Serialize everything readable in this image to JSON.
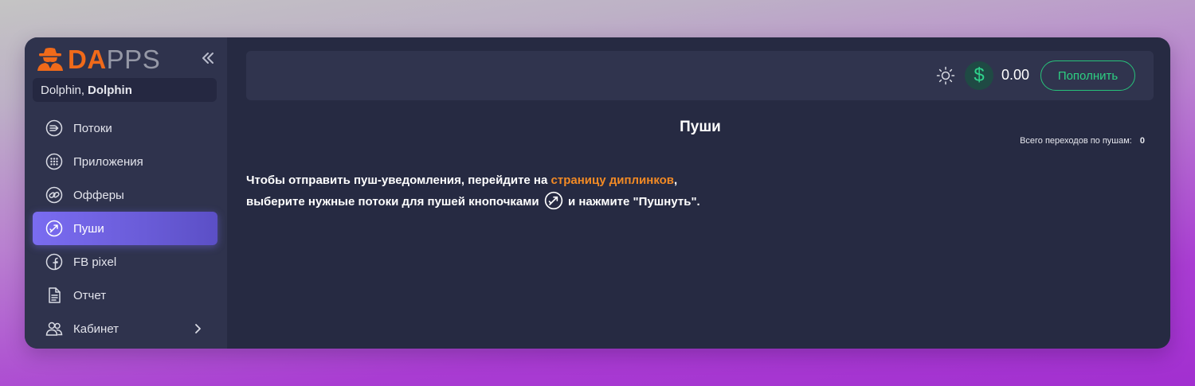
{
  "brand": {
    "logo_da": "DA",
    "logo_pps": "PPS",
    "accent": "#f06a1a"
  },
  "user": {
    "first": "Dolphin,",
    "last": "Dolphin"
  },
  "sidebar": {
    "items": [
      {
        "label": "Потоки",
        "icon": "streams-icon"
      },
      {
        "label": "Приложения",
        "icon": "apps-grid-icon"
      },
      {
        "label": "Офферы",
        "icon": "link-icon"
      },
      {
        "label": "Пуши",
        "icon": "push-icon",
        "active": true
      },
      {
        "label": "FB pixel",
        "icon": "facebook-icon"
      },
      {
        "label": "Отчет",
        "icon": "document-icon"
      },
      {
        "label": "Кабинет",
        "icon": "users-icon",
        "has_submenu": true
      }
    ]
  },
  "topbar": {
    "balance": "0.00",
    "currency_symbol": "$",
    "topup_label": "Пополнить"
  },
  "main": {
    "title": "Пуши",
    "stats_label": "Всего переходов по пушам:",
    "stats_value": "0",
    "info_line1_prefix": "Чтобы отправить пуш-уведомления, перейдите на ",
    "info_link": "страницу диплинков",
    "info_line1_suffix": ",",
    "info_line2_prefix": "выберите нужные потоки для пушей кнопочками",
    "info_line2_suffix": "и нажмите \"Пушнуть\"."
  },
  "colors": {
    "active_nav": "#7a6cf1",
    "success": "#2dd082",
    "link": "#f28a25",
    "bg": "#262a42",
    "sidebar_bg": "#2f334d"
  }
}
